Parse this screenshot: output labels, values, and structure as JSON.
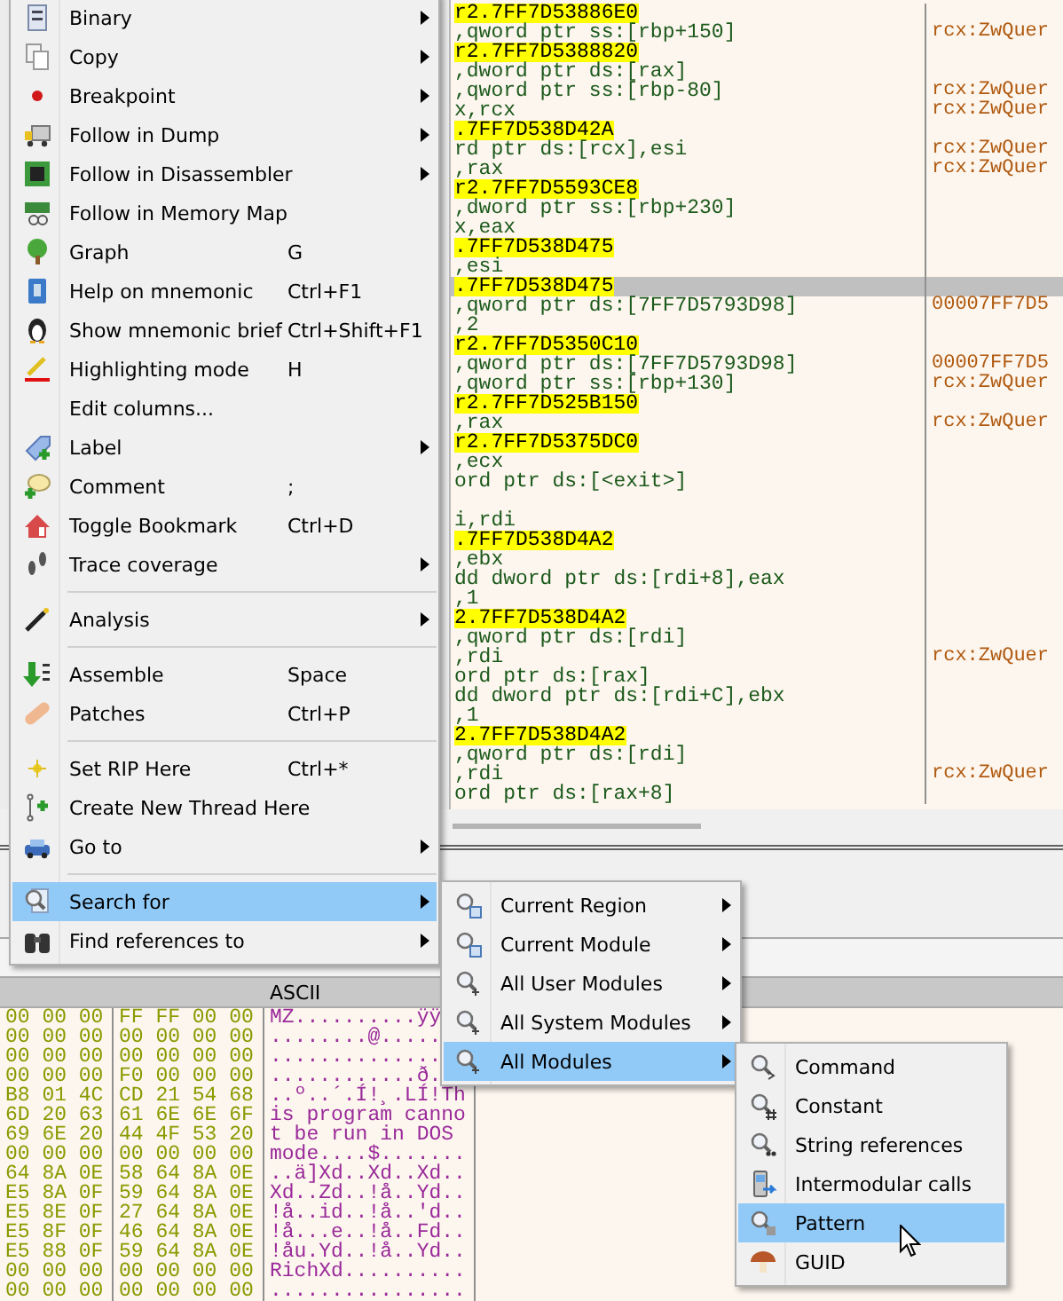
{
  "disassembly": {
    "lines": [
      {
        "kind": "address",
        "text": "r2.7FF7D53886E0",
        "selected": false
      },
      {
        "kind": "code",
        "text": ",qword ptr ss:[rbp+150]",
        "comment": "rcx:ZwQuer",
        "selected": false
      },
      {
        "kind": "address",
        "text": "r2.7FF7D5388820",
        "selected": false
      },
      {
        "kind": "code",
        "text": ",dword ptr ds:[rax]",
        "selected": false
      },
      {
        "kind": "code",
        "text": ",qword ptr ss:[rbp-80]",
        "comment": "rcx:ZwQuer",
        "selected": false
      },
      {
        "kind": "code",
        "text": "x,rcx",
        "comment": "rcx:ZwQuer",
        "selected": false
      },
      {
        "kind": "address",
        "text": ".7FF7D538D42A",
        "selected": false
      },
      {
        "kind": "code",
        "text": "rd ptr ds:[rcx],esi",
        "comment": "rcx:ZwQuer",
        "selected": false
      },
      {
        "kind": "code",
        "text": ",rax",
        "comment": "rcx:ZwQuer",
        "selected": false
      },
      {
        "kind": "address",
        "text": "r2.7FF7D5593CE8",
        "selected": false
      },
      {
        "kind": "code",
        "text": ",dword ptr ss:[rbp+230]",
        "selected": false
      },
      {
        "kind": "code",
        "text": "x,eax",
        "selected": false
      },
      {
        "kind": "address",
        "text": ".7FF7D538D475",
        "selected": false
      },
      {
        "kind": "code",
        "text": ",esi",
        "selected": false
      },
      {
        "kind": "address",
        "text": ".7FF7D538D475",
        "selected": true
      },
      {
        "kind": "code",
        "text": ",qword ptr ds:[7FF7D5793D98]",
        "comment": "00007FF7D5",
        "selected": false
      },
      {
        "kind": "code",
        "text": ",2",
        "selected": false
      },
      {
        "kind": "address",
        "text": "r2.7FF7D5350C10",
        "selected": false
      },
      {
        "kind": "code",
        "text": ",qword ptr ds:[7FF7D5793D98]",
        "comment": "00007FF7D5",
        "selected": false
      },
      {
        "kind": "code",
        "text": ",qword ptr ss:[rbp+130]",
        "comment": "rcx:ZwQuer",
        "selected": false
      },
      {
        "kind": "address",
        "text": "r2.7FF7D525B150",
        "selected": false
      },
      {
        "kind": "code",
        "text": ",rax",
        "comment": "rcx:ZwQuer",
        "selected": false
      },
      {
        "kind": "address",
        "text": "r2.7FF7D5375DC0",
        "selected": false
      },
      {
        "kind": "code",
        "text": ",ecx",
        "selected": false
      },
      {
        "kind": "code",
        "text": "ord ptr ds:[<exit>]",
        "selected": false
      },
      {
        "kind": "blank",
        "selected": false
      },
      {
        "kind": "code",
        "text": "i,rdi",
        "selected": false
      },
      {
        "kind": "address",
        "text": ".7FF7D538D4A2",
        "selected": false
      },
      {
        "kind": "code",
        "text": ",ebx",
        "selected": false
      },
      {
        "kind": "code",
        "text": "dd dword ptr ds:[rdi+8],eax",
        "selected": false
      },
      {
        "kind": "code",
        "text": ",1",
        "selected": false
      },
      {
        "kind": "address",
        "text": "2.7FF7D538D4A2",
        "selected": false
      },
      {
        "kind": "code",
        "text": ",qword ptr ds:[rdi]",
        "selected": false
      },
      {
        "kind": "code",
        "text": ",rdi",
        "comment": "rcx:ZwQuer",
        "selected": false
      },
      {
        "kind": "code",
        "text": "ord ptr ds:[rax]",
        "selected": false
      },
      {
        "kind": "code",
        "text": "dd dword ptr ds:[rdi+C],ebx",
        "selected": false
      },
      {
        "kind": "code",
        "text": ",1",
        "selected": false
      },
      {
        "kind": "address",
        "text": "2.7FF7D538D4A2",
        "selected": false
      },
      {
        "kind": "code",
        "text": ",qword ptr ds:[rdi]",
        "selected": false
      },
      {
        "kind": "code",
        "text": ",rdi",
        "comment": "rcx:ZwQuer",
        "selected": false
      },
      {
        "kind": "code",
        "text": "ord ptr ds:[rax+8]",
        "selected": false
      }
    ]
  },
  "dump": {
    "ascii_header": "ASCII",
    "rows": [
      {
        "bytes_1": "00 00 00",
        "bytes_2": "FF FF 00 00",
        "ascii": "MZ..........ÿÿ"
      },
      {
        "bytes_1": "00 00 00",
        "bytes_2": "00 00 00 00",
        "ascii": "........@....."
      },
      {
        "bytes_1": "00 00 00",
        "bytes_2": "00 00 00 00",
        "ascii": ".............."
      },
      {
        "bytes_1": "00 00 00",
        "bytes_2": "F0 00 00 00",
        "ascii": "............ð."
      },
      {
        "bytes_1": "B8 01 4C",
        "bytes_2": "CD 21 54 68",
        "ascii": "..º..´.Í!¸.LÍ!Th"
      },
      {
        "bytes_1": "6D 20 63",
        "bytes_2": "61 6E 6E 6F",
        "ascii": "is program canno"
      },
      {
        "bytes_1": "69 6E 20",
        "bytes_2": "44 4F 53 20",
        "ascii": "t be run in DOS "
      },
      {
        "bytes_1": "00 00 00",
        "bytes_2": "00 00 00 00",
        "ascii": "mode....$......."
      },
      {
        "bytes_1": "64 8A 0E",
        "bytes_2": "58 64 8A 0E",
        "ascii": "..ä]Xd..Xd..Xd.."
      },
      {
        "bytes_1": "E5 8A 0F",
        "bytes_2": "59 64 8A 0E",
        "ascii": "Xd..Zd..!å..Yd.."
      },
      {
        "bytes_1": "E5 8E 0F",
        "bytes_2": "27 64 8A 0E",
        "ascii": "!å..id..!å..'d.."
      },
      {
        "bytes_1": "E5 8F 0F",
        "bytes_2": "46 64 8A 0E",
        "ascii": "!å...e..!å..Fd.."
      },
      {
        "bytes_1": "E5 88 0F",
        "bytes_2": "59 64 8A 0E",
        "ascii": "!åu.Yd..!å..Yd.."
      },
      {
        "bytes_1": "00 00 00",
        "bytes_2": "00 00 00 00",
        "ascii": "RichXd.........."
      },
      {
        "bytes_1": "00 00 00",
        "bytes_2": "00 00 00 00",
        "ascii": "................"
      }
    ]
  },
  "context_menu": {
    "items": [
      {
        "label": "Binary",
        "submenu": true,
        "separator_before": false,
        "selected": false
      },
      {
        "label": "Copy",
        "submenu": true,
        "separator_before": false,
        "selected": false
      },
      {
        "label": "Breakpoint",
        "submenu": true,
        "separator_before": false,
        "selected": false
      },
      {
        "label": "Follow in Dump",
        "submenu": true,
        "separator_before": false,
        "selected": false
      },
      {
        "label": "Follow in Disassembler",
        "submenu": true,
        "separator_before": false,
        "selected": false
      },
      {
        "label": "Follow in Memory Map",
        "submenu": false,
        "separator_before": false,
        "selected": false
      },
      {
        "label": "Graph",
        "shortcut": "G",
        "submenu": false,
        "separator_before": false,
        "selected": false
      },
      {
        "label": "Help on mnemonic",
        "shortcut": "Ctrl+F1",
        "submenu": false,
        "separator_before": false,
        "selected": false
      },
      {
        "label": "Show mnemonic brief",
        "shortcut": "Ctrl+Shift+F1",
        "submenu": false,
        "separator_before": false,
        "selected": false
      },
      {
        "label": "Highlighting mode",
        "shortcut": "H",
        "submenu": false,
        "separator_before": false,
        "selected": false
      },
      {
        "label": "Edit columns...",
        "submenu": false,
        "separator_before": false,
        "selected": false
      },
      {
        "label": "Label",
        "submenu": true,
        "separator_before": false,
        "selected": false
      },
      {
        "label": "Comment",
        "shortcut": ";",
        "submenu": false,
        "separator_before": false,
        "selected": false
      },
      {
        "label": "Toggle Bookmark",
        "shortcut": "Ctrl+D",
        "submenu": false,
        "separator_before": false,
        "selected": false
      },
      {
        "label": "Trace coverage",
        "submenu": true,
        "separator_before": false,
        "selected": false
      },
      {
        "label": "Analysis",
        "submenu": true,
        "separator_before": true,
        "selected": false
      },
      {
        "label": "Assemble",
        "shortcut": "Space",
        "submenu": false,
        "separator_before": true,
        "selected": false
      },
      {
        "label": "Patches",
        "shortcut": "Ctrl+P",
        "submenu": false,
        "separator_before": false,
        "selected": false
      },
      {
        "label": "Set RIP Here",
        "shortcut": "Ctrl+*",
        "submenu": false,
        "separator_before": true,
        "selected": false
      },
      {
        "label": "Create New Thread Here",
        "submenu": false,
        "separator_before": false,
        "selected": false
      },
      {
        "label": "Go to",
        "submenu": true,
        "separator_before": false,
        "selected": false
      },
      {
        "label": "Search for",
        "submenu": true,
        "separator_before": true,
        "selected": true
      },
      {
        "label": "Find references to",
        "submenu": true,
        "separator_before": false,
        "selected": false
      }
    ]
  },
  "search_submenu": {
    "items": [
      {
        "label": "Current Region",
        "submenu": true,
        "selected": false
      },
      {
        "label": "Current Module",
        "submenu": true,
        "selected": false
      },
      {
        "label": "All User Modules",
        "submenu": true,
        "selected": false
      },
      {
        "label": "All System Modules",
        "submenu": true,
        "selected": false
      },
      {
        "label": "All Modules",
        "submenu": true,
        "selected": true
      }
    ]
  },
  "modules_submenu": {
    "items": [
      {
        "label": "Command",
        "selected": false
      },
      {
        "label": "Constant",
        "selected": false
      },
      {
        "label": "String references",
        "selected": false
      },
      {
        "label": "Intermodular calls",
        "selected": false
      },
      {
        "label": "Pattern",
        "selected": true
      },
      {
        "label": "GUID",
        "selected": false
      }
    ]
  }
}
